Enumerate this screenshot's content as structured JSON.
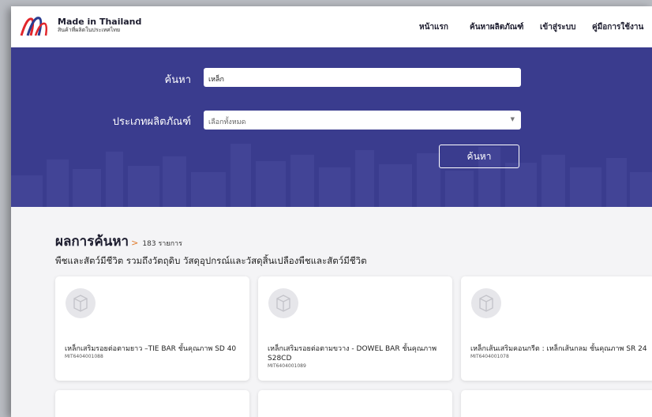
{
  "header": {
    "brand_title": "Made in Thailand",
    "brand_subtitle": "สินค้าที่ผลิตในประเทศไทย",
    "nav": [
      {
        "label": "หน้าแรก"
      },
      {
        "label": "ค้นหาผลิตภัณฑ์"
      },
      {
        "label": "เข้าสู่ระบบ"
      },
      {
        "label": "คู่มือการใช้งาน"
      }
    ]
  },
  "search": {
    "keyword_label": "ค้นหา",
    "keyword_value": "เหล็ก",
    "type_label": "ประเภทผลิตภัณฑ์",
    "type_value": "เลือกทั้งหมด",
    "button_label": "ค้นหา"
  },
  "results": {
    "title": "ผลการค้นหา",
    "chevron": ">",
    "count": "183 รายการ",
    "category": "พืชและสัตว์มีชีวิต รวมถึงวัตถุดิบ วัสดุอุปกรณ์และวัสดุสิ้นเปลืองพืชและสัตว์มีชีวิต",
    "items": [
      {
        "name": "เหล็กเสริมรอยต่อตามยาว –TIE BAR ชั้นคุณภาพ SD 40",
        "code": "MIT6404001088"
      },
      {
        "name": "เหล็กเสริมรอยต่อตามขวาง - DOWEL BAR ชั้นคุณภาพ S28CD",
        "code": "MIT6404001089"
      },
      {
        "name": "เหล็กเส้นเสริมคอนกรีต : เหล็กเส้นกลม ชั้นคุณภาพ SR 24",
        "code": "MIT6404001078"
      }
    ]
  },
  "colors": {
    "hero_bg": "#3a3c8e",
    "logo_red": "#e2262b",
    "logo_blue": "#2b3c8f",
    "accent_orange": "#e07a2a"
  }
}
